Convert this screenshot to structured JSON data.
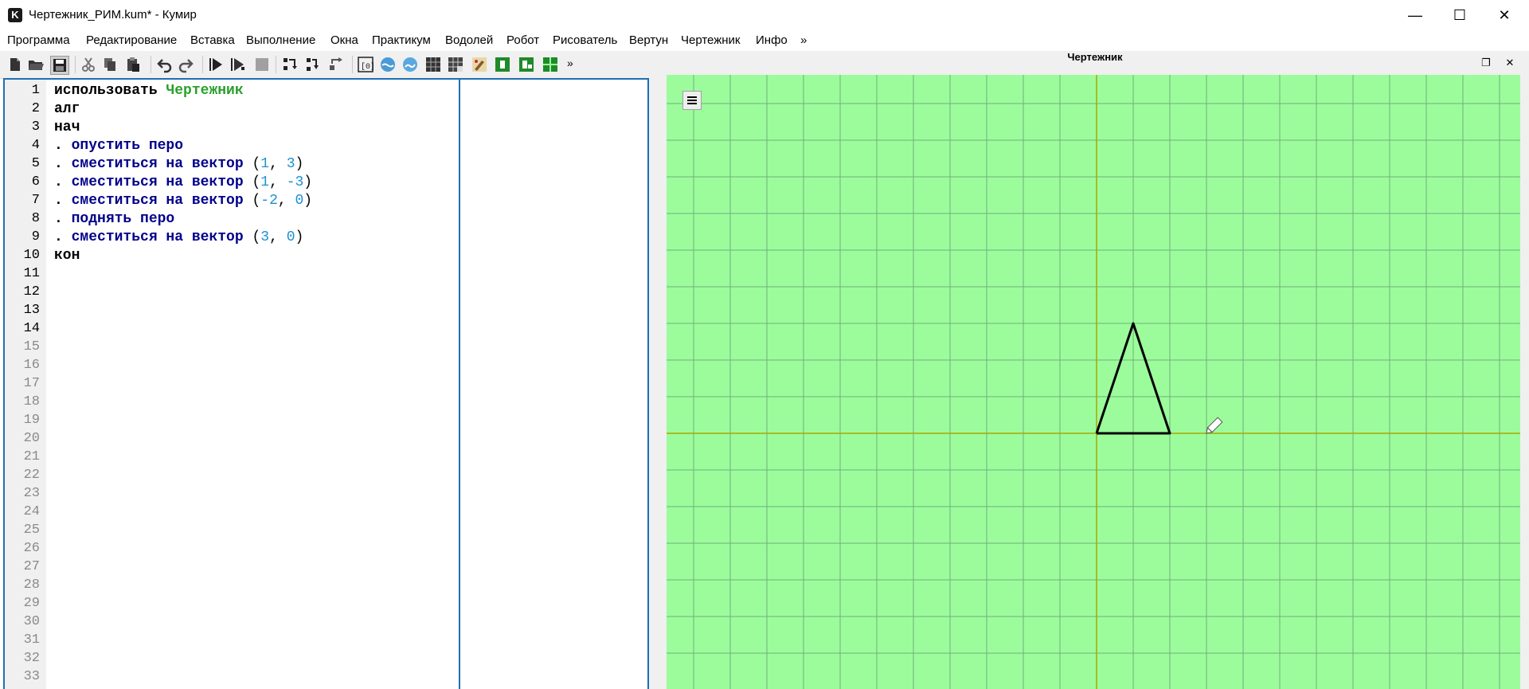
{
  "window": {
    "title": "Чертежник_РИМ.kum* - Кумир",
    "app_icon_letter": "K",
    "controls": {
      "minimize_glyph": "—",
      "maximize_glyph": "☐",
      "close_glyph": "✕"
    }
  },
  "menubar": {
    "items": [
      "Программа",
      "Редактирование",
      "Вставка",
      "Выполнение",
      "Окна",
      "Практикум",
      "Водолей",
      "Робот",
      "Рисователь",
      "Вертун",
      "Чертежник",
      "Инфо",
      "»"
    ]
  },
  "toolbar": {
    "buttons": [
      "new-file-icon",
      "open-folder-icon",
      "save-icon",
      "cut-icon",
      "copy-icon",
      "paste-icon",
      "undo-icon",
      "redo-icon",
      "run-icon",
      "run-step-icon",
      "stop-icon",
      "step-over-icon",
      "step-into-icon",
      "step-out-icon",
      "variables-icon",
      "vodolei-icon",
      "robot-icon",
      "grid-icon",
      "robot-field-icon",
      "painter-icon",
      "vertun-icon",
      "chertezhnik-icon",
      "field-icon"
    ],
    "overflow": "»"
  },
  "editor": {
    "line_numbers": [
      "1",
      "2",
      "3",
      "4",
      "5",
      "6",
      "7",
      "8",
      "9",
      "10",
      "11",
      "12",
      "13",
      "14",
      "15",
      "16",
      "17",
      "18",
      "19",
      "20",
      "21",
      "22",
      "23",
      "24",
      "25",
      "26",
      "27",
      "28",
      "29",
      "30",
      "31",
      "32",
      "33"
    ],
    "code_lines": [
      [
        {
          "t": "использовать ",
          "c": "kw"
        },
        {
          "t": "Чертежник",
          "c": "mod"
        }
      ],
      [
        {
          "t": "алг",
          "c": "kw"
        }
      ],
      [
        {
          "t": "нач",
          "c": "kw"
        }
      ],
      [
        {
          "t": ". ",
          "c": "kw"
        },
        {
          "t": "опустить перо",
          "c": "cmd"
        }
      ],
      [
        {
          "t": ". ",
          "c": "kw"
        },
        {
          "t": "сместиться на вектор ",
          "c": "cmd"
        },
        {
          "t": "(",
          "c": "punc"
        },
        {
          "t": "1",
          "c": "num"
        },
        {
          "t": ", ",
          "c": "punc"
        },
        {
          "t": "3",
          "c": "num"
        },
        {
          "t": ")",
          "c": "punc"
        }
      ],
      [
        {
          "t": ". ",
          "c": "kw"
        },
        {
          "t": "сместиться на вектор ",
          "c": "cmd"
        },
        {
          "t": "(",
          "c": "punc"
        },
        {
          "t": "1",
          "c": "num"
        },
        {
          "t": ", ",
          "c": "punc"
        },
        {
          "t": "-3",
          "c": "num"
        },
        {
          "t": ")",
          "c": "punc"
        }
      ],
      [
        {
          "t": ". ",
          "c": "kw"
        },
        {
          "t": "сместиться на вектор ",
          "c": "cmd"
        },
        {
          "t": "(",
          "c": "punc"
        },
        {
          "t": "-2",
          "c": "num"
        },
        {
          "t": ", ",
          "c": "punc"
        },
        {
          "t": "0",
          "c": "num"
        },
        {
          "t": ")",
          "c": "punc"
        }
      ],
      [
        {
          "t": ". ",
          "c": "kw"
        },
        {
          "t": "поднять перо",
          "c": "cmd"
        }
      ],
      [
        {
          "t": ". ",
          "c": "kw"
        },
        {
          "t": "сместиться на вектор ",
          "c": "cmd"
        },
        {
          "t": "(",
          "c": "punc"
        },
        {
          "t": "3",
          "c": "num"
        },
        {
          "t": ", ",
          "c": "punc"
        },
        {
          "t": "0",
          "c": "num"
        },
        {
          "t": ")",
          "c": "punc"
        }
      ],
      [
        {
          "t": "кон",
          "c": "kw"
        }
      ]
    ]
  },
  "drawer": {
    "title": "Чертежник",
    "float_glyph": "❐",
    "close_glyph": "✕",
    "canvas_bg": "#9cfc9c",
    "grid_color": "#6fb07a",
    "axis_color": "#a8a800",
    "path_color": "#000000",
    "drawn_path": [
      [
        0,
        0
      ],
      [
        1,
        3
      ],
      [
        2,
        0
      ],
      [
        0,
        0
      ]
    ],
    "pen_position": [
      3,
      0
    ],
    "pen_raised": true
  },
  "colors": {
    "accent_border": "#1f6fb2",
    "gutter_bg": "#f0f0f0",
    "keyword": "#000000",
    "command": "#00008b",
    "module": "#2aa02a",
    "number": "#1e90d2"
  }
}
